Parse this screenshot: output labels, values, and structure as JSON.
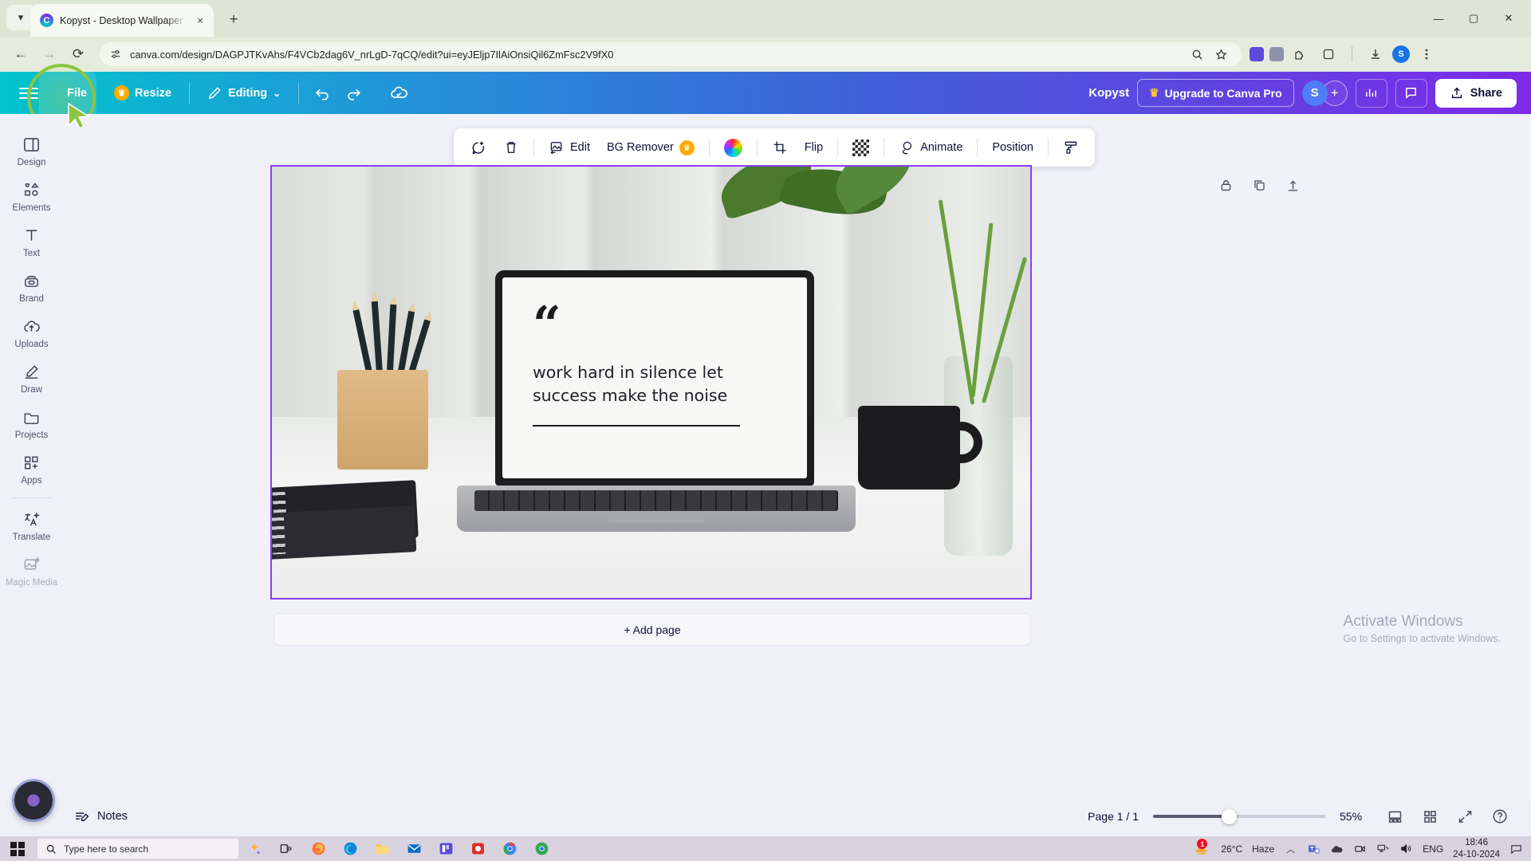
{
  "browser": {
    "tab": {
      "title": "Kopyst - Desktop Wallpaper - C",
      "favicon": "canva-icon",
      "close": "×",
      "chevron": "▾",
      "newtab": "+"
    },
    "window_controls": {
      "minimize": "—",
      "maximize": "▢",
      "close": "✕"
    },
    "nav": {
      "back": "←",
      "forward": "→",
      "reload": "⟳"
    },
    "omnibox": {
      "url": "canva.com/design/DAGPJTKvAhs/F4VCb2dag6V_nrLgD-7qCQ/edit?ui=eyJEljp7IlAiOnsiQil6ZmFsc2V9fX0",
      "site_icon": "site-settings-icon",
      "zoom_icon": "zoom-icon",
      "bookmark_icon": "star-icon",
      "download_icon": "download-icon",
      "menu_icon": "kebab-menu-icon",
      "profile_initial": "S"
    }
  },
  "canva_top": {
    "menu_icon": "hamburger-icon",
    "file_label": "File",
    "resize_label": "Resize",
    "resize_badge": "crown-icon",
    "editing_label": "Editing",
    "editing_caret": "⌄",
    "undo_icon": "undo-icon",
    "redo_icon": "redo-icon",
    "cloud_icon": "cloud-saved-icon",
    "brand_name": "Kopyst",
    "upgrade_label": "Upgrade to Canva Pro",
    "avatar_initial": "S",
    "add_collaborator": "+",
    "insights_icon": "bar-chart-icon",
    "comments_icon": "comment-icon",
    "share_label": "Share",
    "share_icon": "upload-icon"
  },
  "rail": {
    "items": [
      {
        "label": "Design",
        "icon": "design-panel-icon"
      },
      {
        "label": "Elements",
        "icon": "shapes-icon"
      },
      {
        "label": "Text",
        "icon": "text-t-icon"
      },
      {
        "label": "Brand",
        "icon": "brand-kit-icon"
      },
      {
        "label": "Uploads",
        "icon": "cloud-upload-icon"
      },
      {
        "label": "Draw",
        "icon": "pen-icon"
      },
      {
        "label": "Projects",
        "icon": "folder-icon"
      },
      {
        "label": "Apps",
        "icon": "apps-grid-icon"
      },
      {
        "label": "Translate",
        "icon": "translate-icon"
      },
      {
        "label": "Magic Media",
        "icon": "magic-media-icon"
      }
    ]
  },
  "float_toolbar": {
    "items": [
      {
        "label": "",
        "icon": "comment-add-icon",
        "type": "icon"
      },
      {
        "label": "",
        "icon": "trash-icon",
        "type": "icon"
      },
      {
        "label": "Edit",
        "icon": "edit-image-icon",
        "type": "text-icon"
      },
      {
        "label": "BG Remover",
        "icon": "crown-icon",
        "type": "text-badge"
      },
      {
        "label": "",
        "icon": "color-wheel-icon",
        "type": "icon"
      },
      {
        "label": "",
        "icon": "crop-icon",
        "type": "icon"
      },
      {
        "label": "Flip",
        "icon": "",
        "type": "text"
      },
      {
        "label": "",
        "icon": "transparency-icon",
        "type": "icon"
      },
      {
        "label": "Animate",
        "icon": "animate-icon",
        "type": "text-icon"
      },
      {
        "label": "Position",
        "icon": "",
        "type": "text"
      },
      {
        "label": "",
        "icon": "paint-roller-icon",
        "type": "icon"
      }
    ]
  },
  "page_tools": {
    "lock": "lock-icon",
    "duplicate": "duplicate-icon",
    "expand": "expand-page-icon"
  },
  "canvas": {
    "quote_mark": "“",
    "quote_line1": "work hard in silence let",
    "quote_line2": "success make the noise",
    "add_page_label": "+ Add page"
  },
  "watermark": {
    "title": "Activate Windows",
    "subtitle": "Go to Settings to activate Windows."
  },
  "canva_bottom": {
    "notes_label": "Notes",
    "notes_icon": "notes-icon",
    "page_indicator": "Page 1 / 1",
    "zoom_value": "55%",
    "grid_view_icon": "page-view-icon",
    "thumbnail_icon": "grid-view-icon",
    "fullscreen_icon": "fullscreen-icon",
    "help_icon": "help-icon"
  },
  "taskbar": {
    "start_icon": "windows-start-icon",
    "search_placeholder": "Type here to search",
    "search_icon": "search-icon",
    "apps": [
      {
        "icon": "copilot-icon",
        "name": "copilot"
      },
      {
        "icon": "task-view-icon",
        "name": "task-view"
      },
      {
        "icon": "firefox-icon",
        "name": "firefox"
      },
      {
        "icon": "edge-icon",
        "name": "edge"
      },
      {
        "icon": "file-explorer-icon",
        "name": "file-explorer"
      },
      {
        "icon": "mail-icon",
        "name": "mail"
      },
      {
        "icon": "kopyst-icon",
        "name": "kopyst"
      },
      {
        "icon": "store-icon",
        "name": "store"
      },
      {
        "icon": "chrome-icon",
        "name": "chrome"
      },
      {
        "icon": "chrome-alt-icon",
        "name": "chrome-alt"
      }
    ],
    "tray": {
      "weather_temp": "26°C",
      "weather_cond": "Haze",
      "weather_badge": "1",
      "chevron": "︿",
      "teams_icon": "teams-icon",
      "onedrive_icon": "onedrive-icon",
      "camera_icon": "camera-icon",
      "network_icon": "network-icon",
      "volume_icon": "volume-icon",
      "language": "ENG",
      "time": "18:46",
      "date": "24-10-2024",
      "action_center": "notification-icon"
    }
  },
  "colors": {
    "canva_gradient_start": "#00c4cc",
    "canva_gradient_end": "#7d2ae8",
    "selection_purple": "#8b3dff",
    "highlight_green": "#8bc53f",
    "rail_bg": "#eff0f8",
    "browser_tabstrip": "#dde6d4"
  }
}
